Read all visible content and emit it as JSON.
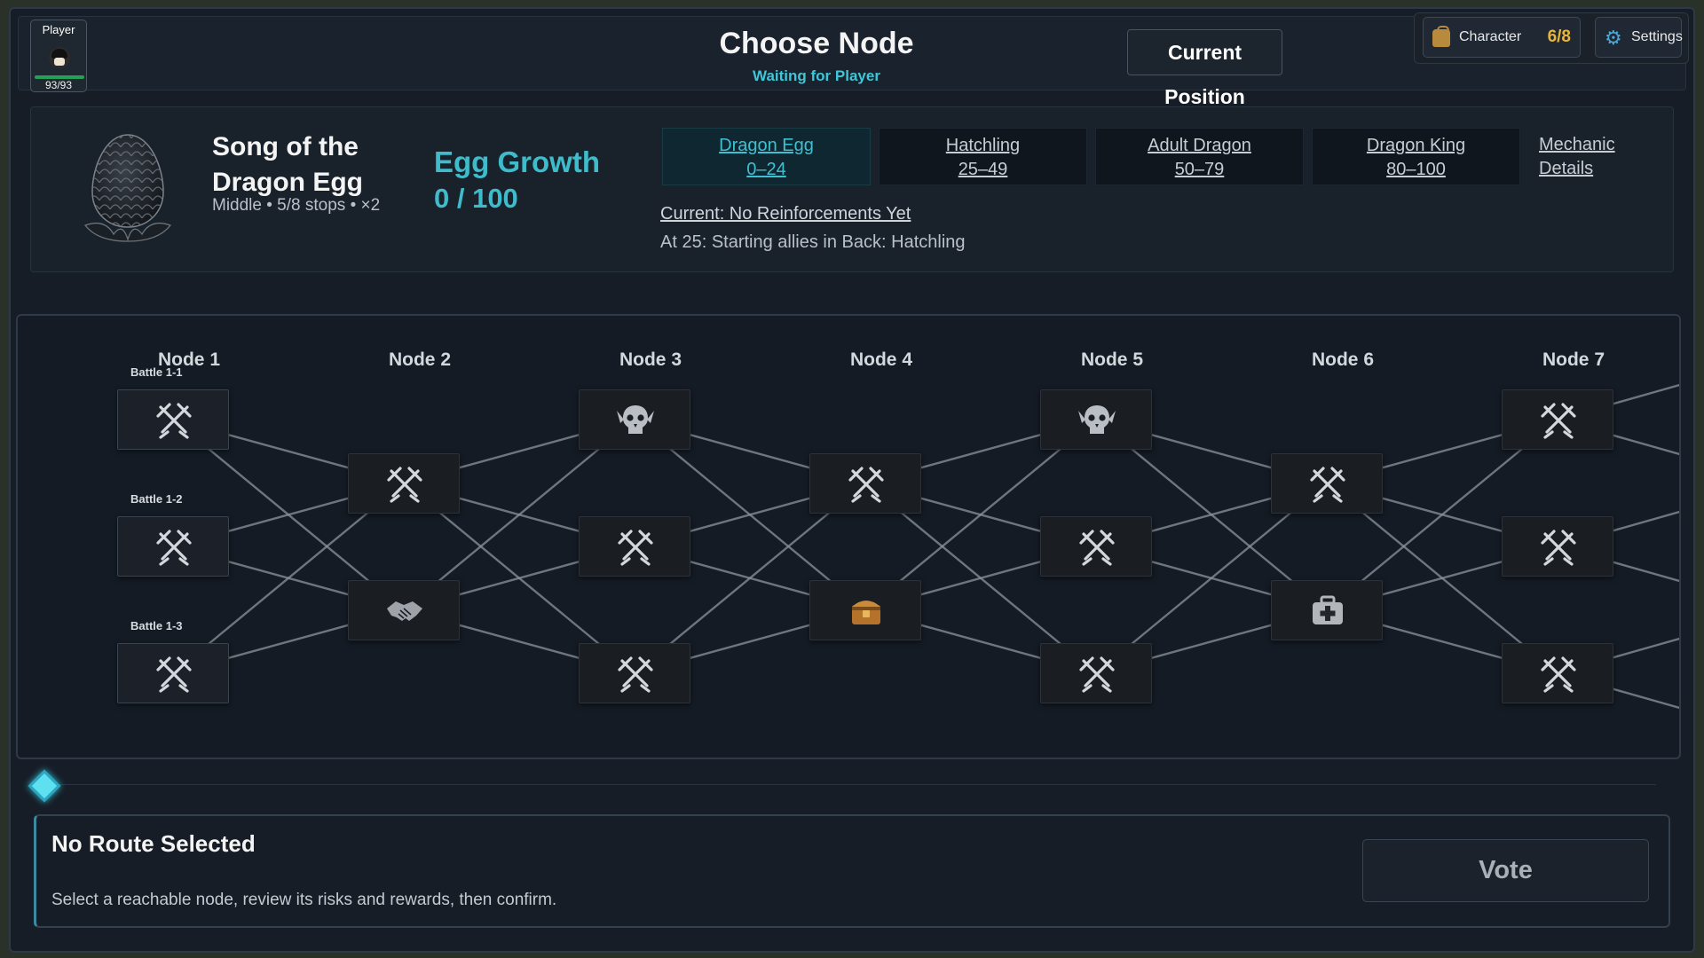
{
  "header": {
    "player_label": "Player",
    "player_hp": "93/93",
    "title": "Choose Node",
    "subtitle": "Waiting for Player",
    "current_position_label": "Current Position",
    "character_label": "Character",
    "character_count": "6/8",
    "settings_label": "Settings"
  },
  "event": {
    "title": "Song of the Dragon Egg",
    "meta": "Middle  •  5/8 stops  •  ×2",
    "growth_label": "Egg Growth",
    "growth_value": "0 / 100",
    "growth_progress": 0,
    "stages": [
      {
        "name": "Dragon Egg",
        "range": "0–24",
        "active": true
      },
      {
        "name": "Hatchling",
        "range": "25–49",
        "active": false
      },
      {
        "name": "Adult Dragon",
        "range": "50–79",
        "active": false
      },
      {
        "name": "Dragon King",
        "range": "80–100",
        "active": false
      }
    ],
    "mechanic_link": "Mechanic Details",
    "reinforcement_current": "Current: No Reinforcements Yet",
    "reinforcement_next": "At 25: Starting allies in Back: Hatchling"
  },
  "map": {
    "columns": [
      "Node 1",
      "Node 2",
      "Node 3",
      "Node 4",
      "Node 5",
      "Node 6",
      "Node 7"
    ],
    "battle_labels": [
      "Battle 1-1",
      "Battle 1-2",
      "Battle 1-3"
    ],
    "nodes": [
      {
        "col": 1,
        "row": 0,
        "type": "battle"
      },
      {
        "col": 1,
        "row": 2,
        "type": "battle"
      },
      {
        "col": 1,
        "row": 4,
        "type": "battle"
      },
      {
        "col": 2,
        "row": 1,
        "type": "battle"
      },
      {
        "col": 2,
        "row": 3,
        "type": "ally"
      },
      {
        "col": 3,
        "row": 0,
        "type": "elite"
      },
      {
        "col": 3,
        "row": 2,
        "type": "battle"
      },
      {
        "col": 3,
        "row": 4,
        "type": "battle"
      },
      {
        "col": 4,
        "row": 1,
        "type": "battle"
      },
      {
        "col": 4,
        "row": 3,
        "type": "treasure"
      },
      {
        "col": 5,
        "row": 0,
        "type": "elite"
      },
      {
        "col": 5,
        "row": 2,
        "type": "battle"
      },
      {
        "col": 5,
        "row": 4,
        "type": "battle"
      },
      {
        "col": 6,
        "row": 1,
        "type": "battle"
      },
      {
        "col": 6,
        "row": 3,
        "type": "rest"
      },
      {
        "col": 7,
        "row": 0,
        "type": "battle"
      },
      {
        "col": 7,
        "row": 2,
        "type": "battle"
      },
      {
        "col": 7,
        "row": 4,
        "type": "battle"
      }
    ]
  },
  "route": {
    "title": "No Route Selected",
    "description": "Select a reachable node, review its risks and rewards, then confirm.",
    "vote_label": "Vote"
  },
  "colors": {
    "accent": "#3fbccc",
    "gold": "#e8b53c",
    "hp_green": "#25a058",
    "line": "#8d949c"
  }
}
